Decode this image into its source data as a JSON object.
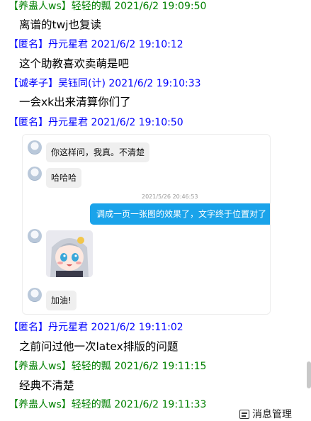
{
  "messages": [
    {
      "header": "【养蛊人ws】轻轻的瓢 2021/6/2 19:09:50",
      "color": "#008000",
      "text": "离谱的twj也复读"
    },
    {
      "header": "【匿名】丹元星君 2021/6/2 19:10:12",
      "color": "#0000ff",
      "text": "这个助教喜欢卖萌是吧"
    },
    {
      "header": "【诚孝子】吴钰同(计) 2021/6/2 19:10:33",
      "color": "#0000ff",
      "text": "一会xk出来清算你们了"
    },
    {
      "header": "【匿名】丹元星君 2021/6/2 19:10:50",
      "color": "#0000ff",
      "text": ""
    },
    {
      "header": "【匿名】丹元星君 2021/6/2 19:11:02",
      "color": "#0000ff",
      "text": "之前问过他一次latex排版的问题"
    },
    {
      "header": "【养蛊人ws】轻轻的瓢 2021/6/2 19:11:15",
      "color": "#008000",
      "text": "经典不清楚"
    },
    {
      "header": "【养蛊人ws】轻轻的瓢 2021/6/2 19:11:33",
      "color": "#008000",
      "text": ""
    }
  ],
  "forwarded": {
    "bubble1": "你这样问，我真。不清楚",
    "bubble2": "哈哈哈",
    "timestamp": "2021/5/26 20:46:53",
    "sent_bubble": "调成一页一张图的效果了，文字终于位置对了",
    "bubble3": "加油!"
  },
  "footer": {
    "message_manager": "消息管理",
    "icon": "message-manager-icon"
  }
}
